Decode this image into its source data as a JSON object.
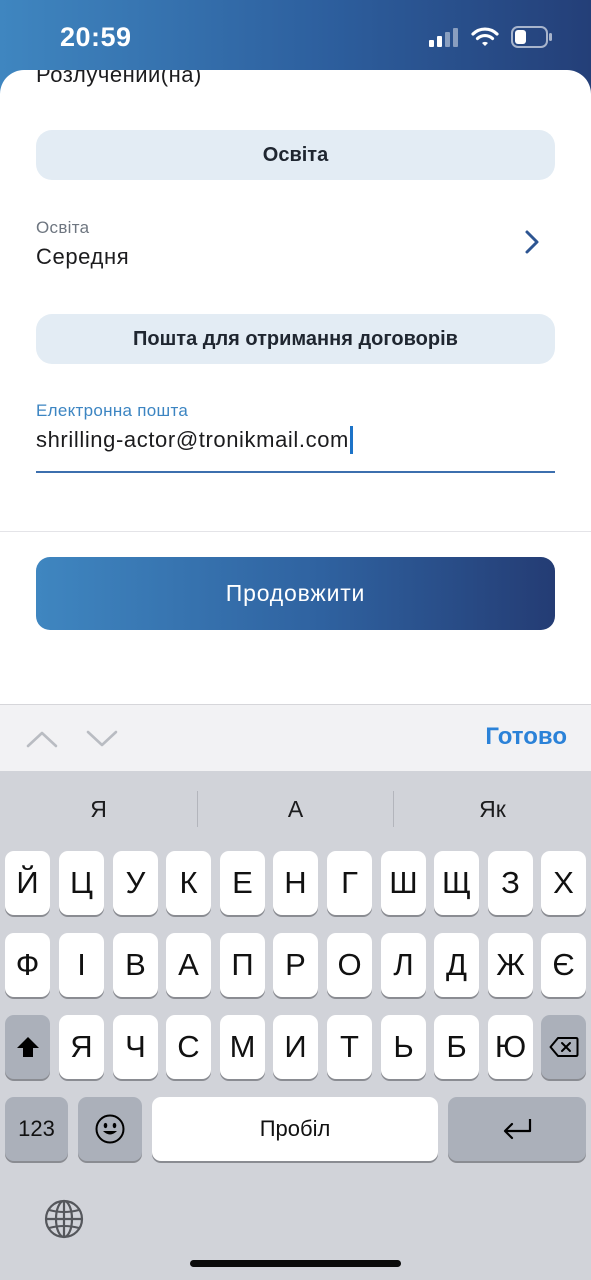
{
  "status_bar": {
    "time": "20:59"
  },
  "form": {
    "cut_off_value": "Розлучений(на)",
    "education_section_title": "Освіта",
    "education_field": {
      "label": "Освіта",
      "value": "Середня"
    },
    "mail_section_title": "Пошта для отримання договорів",
    "email_field": {
      "label": "Електронна пошта",
      "value": "shrilling-actor@tronikmail.com"
    },
    "continue_label": "Продовжити"
  },
  "accessory_bar": {
    "done_label": "Готово"
  },
  "keyboard": {
    "suggestions": [
      "Я",
      "А",
      "Як"
    ],
    "row1": [
      "Й",
      "Ц",
      "У",
      "К",
      "Е",
      "Н",
      "Г",
      "Ш",
      "Щ",
      "З",
      "Х"
    ],
    "row2": [
      "Ф",
      "І",
      "В",
      "А",
      "П",
      "Р",
      "О",
      "Л",
      "Д",
      "Ж",
      "Є"
    ],
    "row3": [
      "Я",
      "Ч",
      "С",
      "М",
      "И",
      "Т",
      "Ь",
      "Б",
      "Ю"
    ],
    "numbers_label": "123",
    "space_label": "Пробіл"
  },
  "colors": {
    "accent_gradient_start": "#3f86c0",
    "accent_gradient_end": "#243c74",
    "section_pill": "#e3ecf4",
    "done_blue": "#2b82d8"
  }
}
